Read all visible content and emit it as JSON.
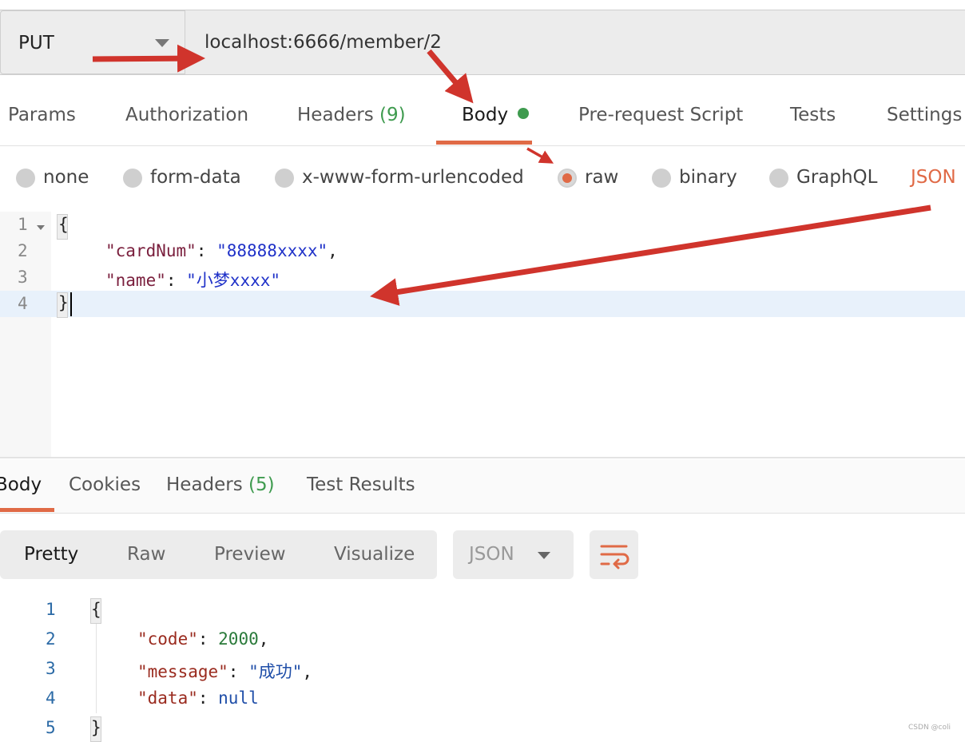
{
  "request": {
    "method": "PUT",
    "url": "localhost:6666/member/2"
  },
  "request_tabs": {
    "params": "Params",
    "authorization": "Authorization",
    "headers": "Headers",
    "headers_count": "(9)",
    "body": "Body",
    "prerequest": "Pre-request Script",
    "tests": "Tests",
    "settings": "Settings"
  },
  "body_types": {
    "none": "none",
    "form_data": "form-data",
    "urlencoded": "x-www-form-urlencoded",
    "raw": "raw",
    "binary": "binary",
    "graphql": "GraphQL",
    "format": "JSON",
    "selected": "raw"
  },
  "request_body": {
    "line_numbers": [
      "1",
      "2",
      "3",
      "4"
    ],
    "open_brace": "{",
    "key1": "\"cardNum\"",
    "val1": "\"88888xxxx\"",
    "key2": "\"name\"",
    "val2": "\"小梦xxxx\"",
    "close_brace": "}"
  },
  "response_tabs": {
    "body": "Body",
    "cookies": "Cookies",
    "headers": "Headers",
    "headers_count": "(5)",
    "test_results": "Test Results"
  },
  "response_view": {
    "pretty": "Pretty",
    "raw": "Raw",
    "preview": "Preview",
    "visualize": "Visualize",
    "format": "JSON"
  },
  "response_body": {
    "line_numbers": [
      "1",
      "2",
      "3",
      "4",
      "5"
    ],
    "open_brace": "{",
    "key1": "\"code\"",
    "val1": "2000",
    "key2": "\"message\"",
    "val2": "\"成功\"",
    "key3": "\"data\"",
    "val3": "null",
    "close_brace": "}"
  },
  "watermark": "CSDN @coli",
  "colors": {
    "accent": "#e06a46",
    "active_green": "#3f9b4f",
    "annotation_red": "#d0342c"
  }
}
